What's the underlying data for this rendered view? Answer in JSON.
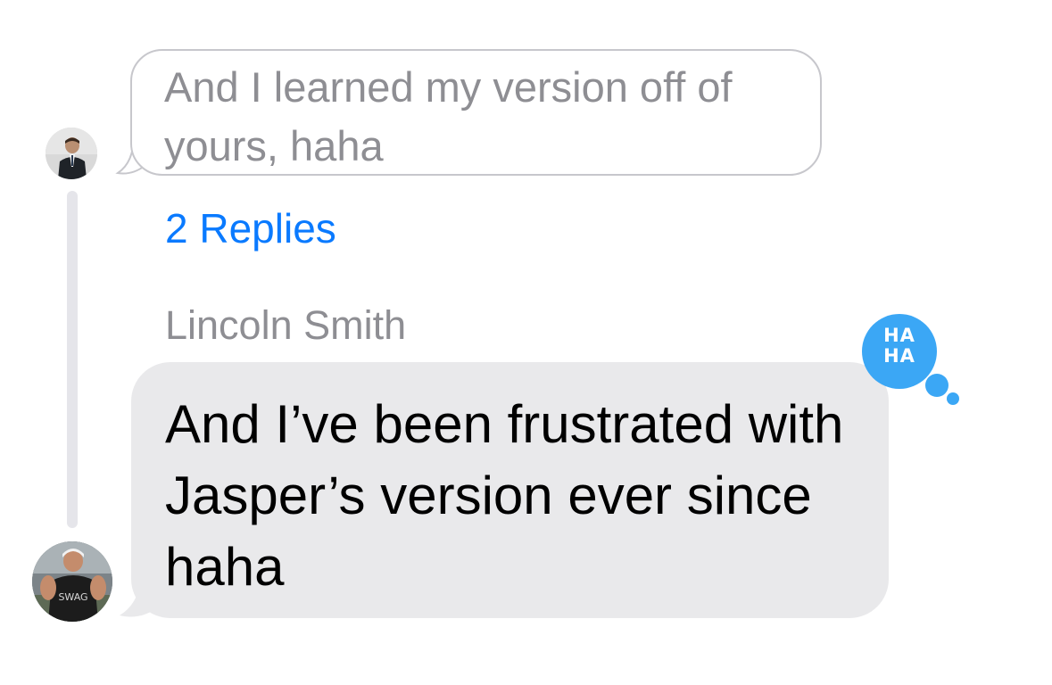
{
  "quoted_message": {
    "text": "And I learned my version off of yours, haha"
  },
  "thread": {
    "replies_label": "2 Replies"
  },
  "reply_message": {
    "sender": "Lincoln Smith",
    "text": "And I’ve been frustrated with Jasper’s version ever since haha"
  },
  "tapback": {
    "label": "HA HA",
    "icon": "haha-reaction-icon",
    "color": "#3ba7f5"
  },
  "colors": {
    "link": "#0a7aff",
    "received_bubble": "#e9e9eb",
    "secondary_text": "#8e8e93"
  }
}
